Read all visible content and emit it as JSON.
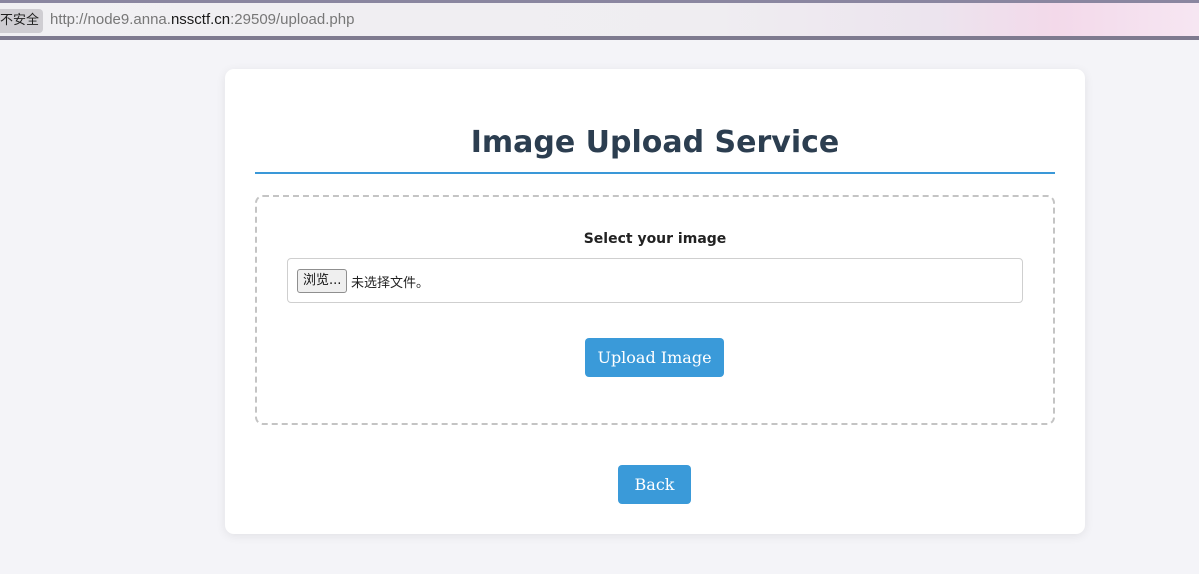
{
  "browser": {
    "security_label": "不安全",
    "url_prefix": "http://node9.anna.",
    "url_host": "nssctf.cn",
    "url_suffix": ":29509/upload.php"
  },
  "page": {
    "title": "Image Upload Service",
    "select_label": "Select your image",
    "browse_label": "浏览...",
    "no_file_text": "未选择文件。",
    "upload_label": "Upload Image",
    "back_label": "Back"
  },
  "colors": {
    "accent": "#3a9ad9",
    "title": "#2c3e50"
  }
}
